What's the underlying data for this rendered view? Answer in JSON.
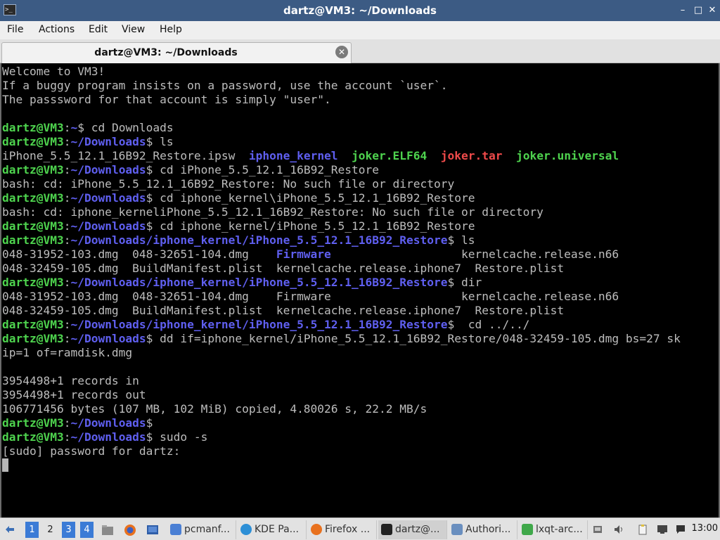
{
  "window": {
    "title": "dartz@VM3: ~/Downloads",
    "controls": {
      "minimize": "–",
      "maximize": "□",
      "close": "✕"
    }
  },
  "menu": [
    "File",
    "Actions",
    "Edit",
    "View",
    "Help"
  ],
  "tab": {
    "label": "dartz@VM3: ~/Downloads",
    "close_glyph": "✕"
  },
  "terminal": {
    "colors": {
      "prompt_user": "#4ed34e",
      "prompt_path": "#5f5ff0",
      "text": "#bdbdbd",
      "error_file": "#ef4a4a"
    },
    "lines": [
      [
        {
          "t": "Welcome to VM3!"
        }
      ],
      [
        {
          "t": "If a buggy program insists on a password, use the account `user`."
        }
      ],
      [
        {
          "t": "The passsword for that account is simply \"user\"."
        }
      ],
      [
        {
          "t": ""
        }
      ],
      [
        {
          "t": "dartz@VM3",
          "c": "pu"
        },
        {
          "t": ":"
        },
        {
          "t": "~",
          "c": "pp"
        },
        {
          "t": "$ cd Downloads"
        }
      ],
      [
        {
          "t": "dartz@VM3",
          "c": "pu"
        },
        {
          "t": ":"
        },
        {
          "t": "~/Downloads",
          "c": "pp"
        },
        {
          "t": "$ ls"
        }
      ],
      [
        {
          "t": "iPhone_5.5_12.1_16B92_Restore.ipsw  "
        },
        {
          "t": "iphone_kernel",
          "c": "fg-blue"
        },
        {
          "t": "  "
        },
        {
          "t": "joker.ELF64",
          "c": "fg-green"
        },
        {
          "t": "  "
        },
        {
          "t": "joker.tar",
          "c": "fg-red"
        },
        {
          "t": "  "
        },
        {
          "t": "joker.universal",
          "c": "fg-green"
        }
      ],
      [
        {
          "t": "dartz@VM3",
          "c": "pu"
        },
        {
          "t": ":"
        },
        {
          "t": "~/Downloads",
          "c": "pp"
        },
        {
          "t": "$ cd iPhone_5.5_12.1_16B92_Restore"
        }
      ],
      [
        {
          "t": "bash: cd: iPhone_5.5_12.1_16B92_Restore: No such file or directory"
        }
      ],
      [
        {
          "t": "dartz@VM3",
          "c": "pu"
        },
        {
          "t": ":"
        },
        {
          "t": "~/Downloads",
          "c": "pp"
        },
        {
          "t": "$ cd iphone_kernel\\iPhone_5.5_12.1_16B92_Restore"
        }
      ],
      [
        {
          "t": "bash: cd: iphone_kerneliPhone_5.5_12.1_16B92_Restore: No such file or directory"
        }
      ],
      [
        {
          "t": "dartz@VM3",
          "c": "pu"
        },
        {
          "t": ":"
        },
        {
          "t": "~/Downloads",
          "c": "pp"
        },
        {
          "t": "$ cd iphone_kernel/iPhone_5.5_12.1_16B92_Restore"
        }
      ],
      [
        {
          "t": "dartz@VM3",
          "c": "pu"
        },
        {
          "t": ":"
        },
        {
          "t": "~/Downloads/iphone_kernel/iPhone_5.5_12.1_16B92_Restore",
          "c": "pp"
        },
        {
          "t": "$ ls"
        }
      ],
      [
        {
          "t": "048-31952-103.dmg  048-32651-104.dmg    "
        },
        {
          "t": "Firmware",
          "c": "fg-blue"
        },
        {
          "t": "                   kernelcache.release.n66"
        }
      ],
      [
        {
          "t": "048-32459-105.dmg  BuildManifest.plist  kernelcache.release.iphone7  Restore.plist"
        }
      ],
      [
        {
          "t": "dartz@VM3",
          "c": "pu"
        },
        {
          "t": ":"
        },
        {
          "t": "~/Downloads/iphone_kernel/iPhone_5.5_12.1_16B92_Restore",
          "c": "pp"
        },
        {
          "t": "$ dir"
        }
      ],
      [
        {
          "t": "048-31952-103.dmg  048-32651-104.dmg    Firmware                   kernelcache.release.n66"
        }
      ],
      [
        {
          "t": "048-32459-105.dmg  BuildManifest.plist  kernelcache.release.iphone7  Restore.plist"
        }
      ],
      [
        {
          "t": "dartz@VM3",
          "c": "pu"
        },
        {
          "t": ":"
        },
        {
          "t": "~/Downloads/iphone_kernel/iPhone_5.5_12.1_16B92_Restore",
          "c": "pp"
        },
        {
          "t": "$  cd ../../"
        }
      ],
      [
        {
          "t": "dartz@VM3",
          "c": "pu"
        },
        {
          "t": ":"
        },
        {
          "t": "~/Downloads",
          "c": "pp"
        },
        {
          "t": "$ dd if=iphone_kernel/iPhone_5.5_12.1_16B92_Restore/048-32459-105.dmg bs=27 sk"
        }
      ],
      [
        {
          "t": "ip=1 of=ramdisk.dmg"
        }
      ],
      [
        {
          "t": ""
        }
      ],
      [
        {
          "t": "3954498+1 records in"
        }
      ],
      [
        {
          "t": "3954498+1 records out"
        }
      ],
      [
        {
          "t": "106771456 bytes (107 MB, 102 MiB) copied, 4.80026 s, 22.2 MB/s"
        }
      ],
      [
        {
          "t": "dartz@VM3",
          "c": "pu"
        },
        {
          "t": ":"
        },
        {
          "t": "~/Downloads",
          "c": "pp"
        },
        {
          "t": "$"
        }
      ],
      [
        {
          "t": "dartz@VM3",
          "c": "pu"
        },
        {
          "t": ":"
        },
        {
          "t": "~/Downloads",
          "c": "pp"
        },
        {
          "t": "$ sudo -s"
        }
      ],
      [
        {
          "t": "[sudo] password for dartz:"
        }
      ]
    ]
  },
  "taskbar": {
    "workspaces": [
      {
        "label": "1",
        "active": true
      },
      {
        "label": "2",
        "active": false
      },
      {
        "label": "3",
        "active": true
      },
      {
        "label": "4",
        "active": true
      }
    ],
    "launchers": [
      "file-manager-icon",
      "firefox-icon",
      "show-desktop-icon"
    ],
    "tasks": [
      {
        "label": "pcmanf...",
        "icon": "folder-icon",
        "color": "#4a7fd4",
        "active": false
      },
      {
        "label": "KDE Pa...",
        "icon": "kde-icon",
        "color": "#2d8fd6",
        "active": false
      },
      {
        "label": "Firefox ...",
        "icon": "firefox-icon",
        "color": "#e8711e",
        "active": false
      },
      {
        "label": "dartz@...",
        "icon": "terminal-icon",
        "color": "#222222",
        "active": true
      },
      {
        "label": "Authori...",
        "icon": "auth-icon",
        "color": "#6a8fbf",
        "active": false
      },
      {
        "label": "lxqt-arc...",
        "icon": "archiver-icon",
        "color": "#3fa84a",
        "active": false
      }
    ],
    "tray": [
      "network-icon",
      "volume-icon",
      "clipboard-icon",
      "display-icon",
      "chat-icon"
    ],
    "clock": "13:00"
  }
}
